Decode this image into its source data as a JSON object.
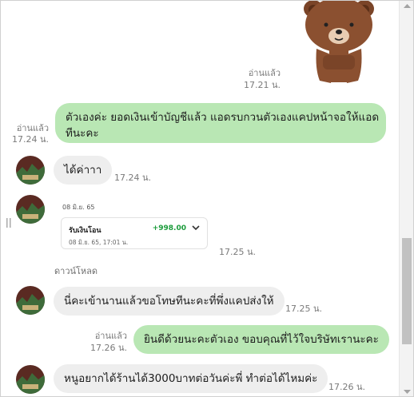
{
  "messages": {
    "m1": {
      "read": "อ่านแล้ว",
      "time": "17.21 น."
    },
    "m2": {
      "text_line1": "ตัวเองค่ะ ยอดเงินเข้าบัญชีแล้ว แอดรบกวนตัวเองแคปหน้าจอให้แอด",
      "text_line2": "ทีนะคะ",
      "read": "อ่านแล้ว",
      "time": "17.24 น."
    },
    "m3": {
      "text": "ได้ค่าาา",
      "time": "17.24 น."
    },
    "m4": {
      "date": "08 มิ.ย. 65",
      "title": "รับเงินโอน",
      "amount": "+998.00",
      "sub": "08 มิ.ย. 65, 17:01 น.",
      "time": "17.25 น.",
      "download": "ดาวน์โหลด"
    },
    "m5": {
      "text": "นี่คะเข้านานแล้วขอโทษทีนะคะที่พึ่งแคปส่งให้",
      "time": "17.25 น."
    },
    "m6": {
      "text": "ยินดีด้วยนะคะตัวเอง ขอบคุณที่ไว้ใจบริษัทเรานะคะ",
      "read": "อ่านแล้ว",
      "time": "17.26 น."
    },
    "m7": {
      "text": "หนูอยากได้ร้านได้3000บาทต่อวันค่ะพี่ ทำต่อได้ไหมค่ะ",
      "time": "17.26 น."
    }
  },
  "colors": {
    "outgoing_bubble": "#b9e7b4",
    "incoming_bubble": "#eeeeee",
    "amount_green": "#1a9b3a"
  },
  "icons": [
    "bear-sticker",
    "avatar",
    "chevron-down-icon",
    "drag-handle-icon",
    "scroll-up-icon",
    "scroll-down-icon"
  ]
}
